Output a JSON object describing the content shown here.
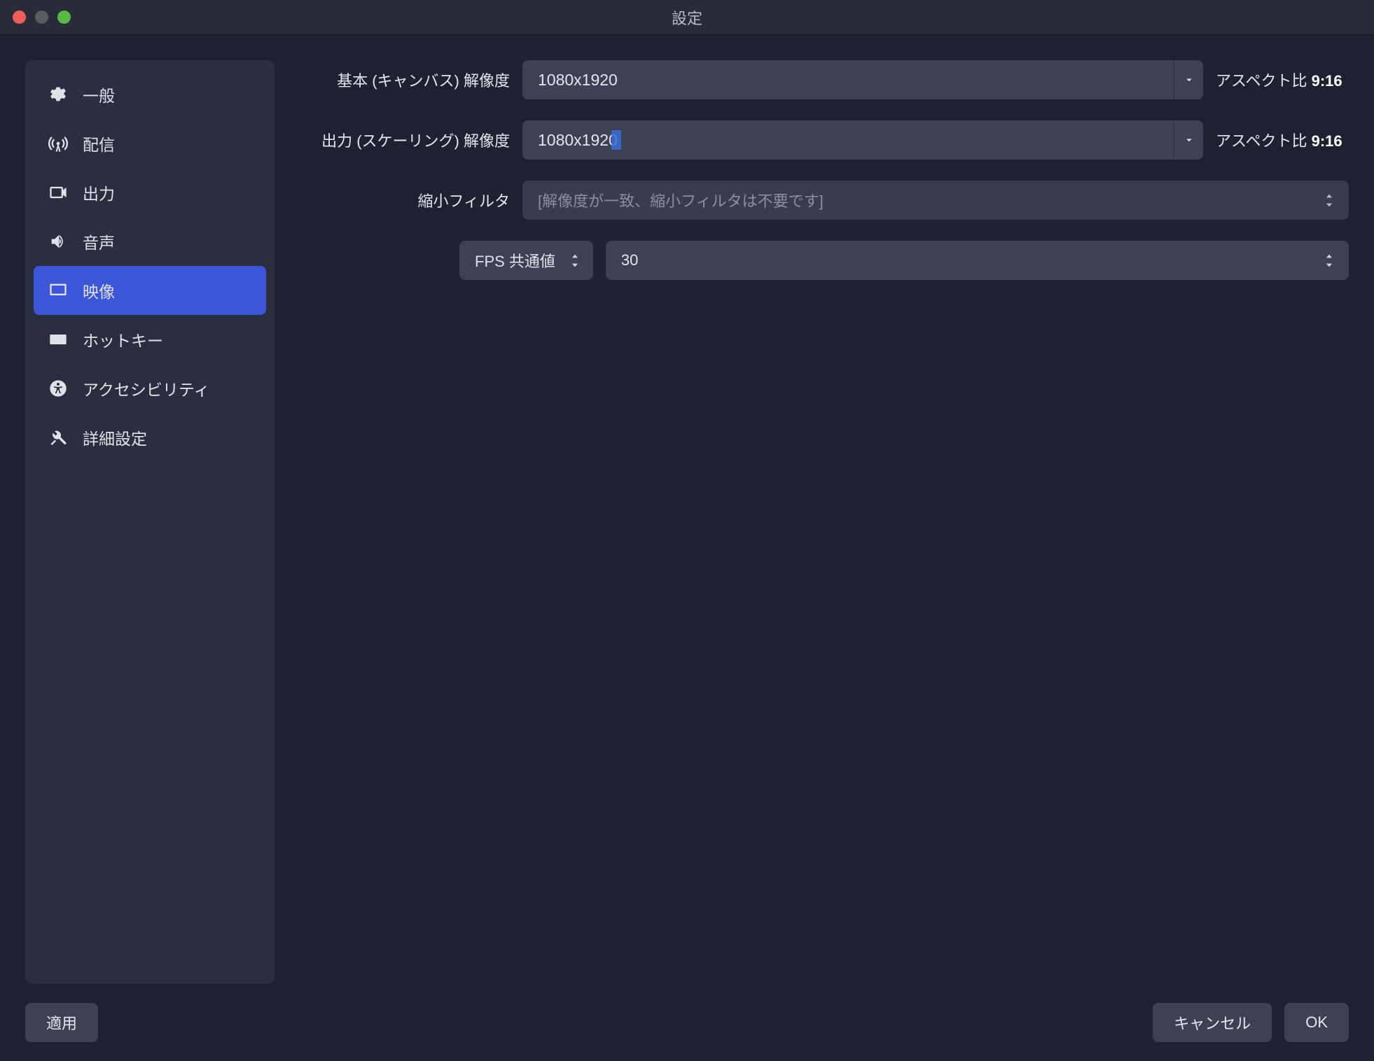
{
  "window": {
    "title": "設定"
  },
  "sidebar": {
    "items": [
      {
        "label": "一般"
      },
      {
        "label": "配信"
      },
      {
        "label": "出力"
      },
      {
        "label": "音声"
      },
      {
        "label": "映像"
      },
      {
        "label": "ホットキー"
      },
      {
        "label": "アクセシビリティ"
      },
      {
        "label": "詳細設定"
      }
    ],
    "active_index": 4
  },
  "video": {
    "base_resolution": {
      "label": "基本 (キャンバス) 解像度",
      "value": "1080x1920",
      "aspect_label": "アスペクト比",
      "aspect_value": "9:16"
    },
    "output_resolution": {
      "label": "出力 (スケーリング) 解像度",
      "value": "1080x1920",
      "aspect_label": "アスペクト比",
      "aspect_value": "9:16"
    },
    "downscale_filter": {
      "label": "縮小フィルタ",
      "value": "[解像度が一致、縮小フィルタは不要です]"
    },
    "fps": {
      "type_label": "FPS 共通値",
      "value": "30"
    }
  },
  "footer": {
    "apply": "適用",
    "cancel": "キャンセル",
    "ok": "OK"
  }
}
